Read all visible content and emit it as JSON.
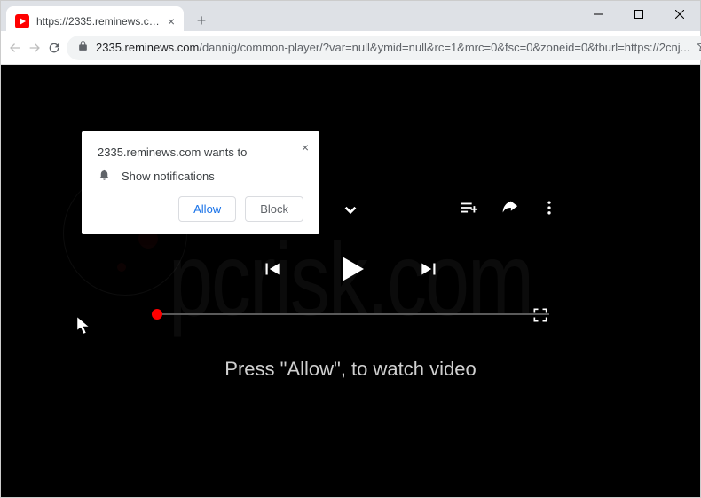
{
  "tab": {
    "title": "https://2335.reminews.com/dann"
  },
  "url": {
    "host": "2335.reminews.com",
    "path": "/dannig/common-player/?var=null&ymid=null&rc=1&mrc=0&fsc=0&zoneid=0&tburl=https://2cnj..."
  },
  "notification": {
    "title_prefix": "2335.reminews.com",
    "title_suffix": " wants to",
    "body": "Show notifications",
    "allow": "Allow",
    "block": "Block"
  },
  "cta": "Press \"Allow\", to watch video",
  "watermark": "pcrisk.com"
}
